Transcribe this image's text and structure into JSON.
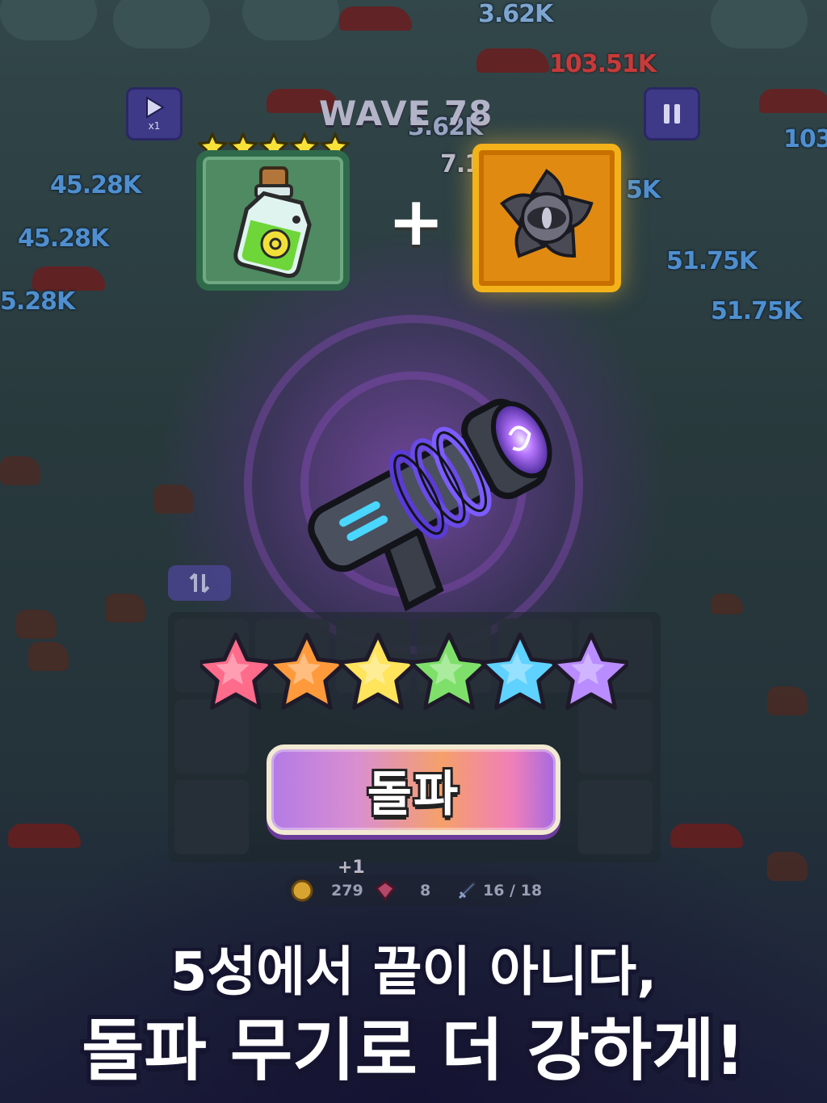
{
  "hud": {
    "wave_label": "WAVE 78",
    "speed_label": "x1"
  },
  "damage_numbers": [
    "3.62K",
    "103.51K",
    "3.62K",
    "7.1",
    "45.28K",
    "45.28K",
    "5.28K",
    "5K",
    "51.75K",
    "51.75K",
    "103"
  ],
  "recipe": {
    "ingredient_1": {
      "icon": "toxic-bottle-icon",
      "stars": 5
    },
    "ingredient_2": {
      "icon": "dark-eye-vortex-icon"
    },
    "operator": "+"
  },
  "result_weapon": {
    "icon": "plasma-vortex-gun-icon",
    "rainbow_stars": 6,
    "star_colors": [
      "#ff6b8a",
      "#ff9a3c",
      "#ffe45c",
      "#7ee06a",
      "#5fd2ff",
      "#b98cff"
    ]
  },
  "breakthrough_button": {
    "label": "돌파"
  },
  "resources": {
    "gold": "279",
    "gold_gain": "+1",
    "gems": "8",
    "unit_count": "16 / 18"
  },
  "headline": {
    "line1": "5성에서 끝이 아니다,",
    "line2": "돌파 무기로 더 강하게!"
  },
  "colors": {
    "card_green": "#4f8a62",
    "card_gold": "#e08a12",
    "glow": "#a050e0",
    "damage_blue": "#4f8fcf"
  }
}
